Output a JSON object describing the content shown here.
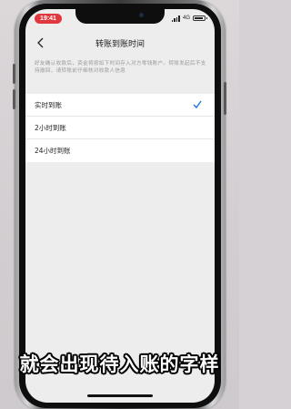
{
  "status_bar": {
    "time": "19:41",
    "network": "4G"
  },
  "nav": {
    "title": "转账到账时间"
  },
  "hint": "好友确认收款后，资金将按如下时间存入对方零钱账户。转账发起后不支持撤回，请转账前仔细核对收款人信息",
  "options": [
    {
      "label": "实时到账",
      "selected": true
    },
    {
      "label": "2小时到账",
      "selected": false
    },
    {
      "label": "24小时到账",
      "selected": false
    }
  ],
  "colors": {
    "accent": "#1e73d8",
    "time_pill": "#e0383e"
  },
  "caption": "就会出现待入账的字样"
}
